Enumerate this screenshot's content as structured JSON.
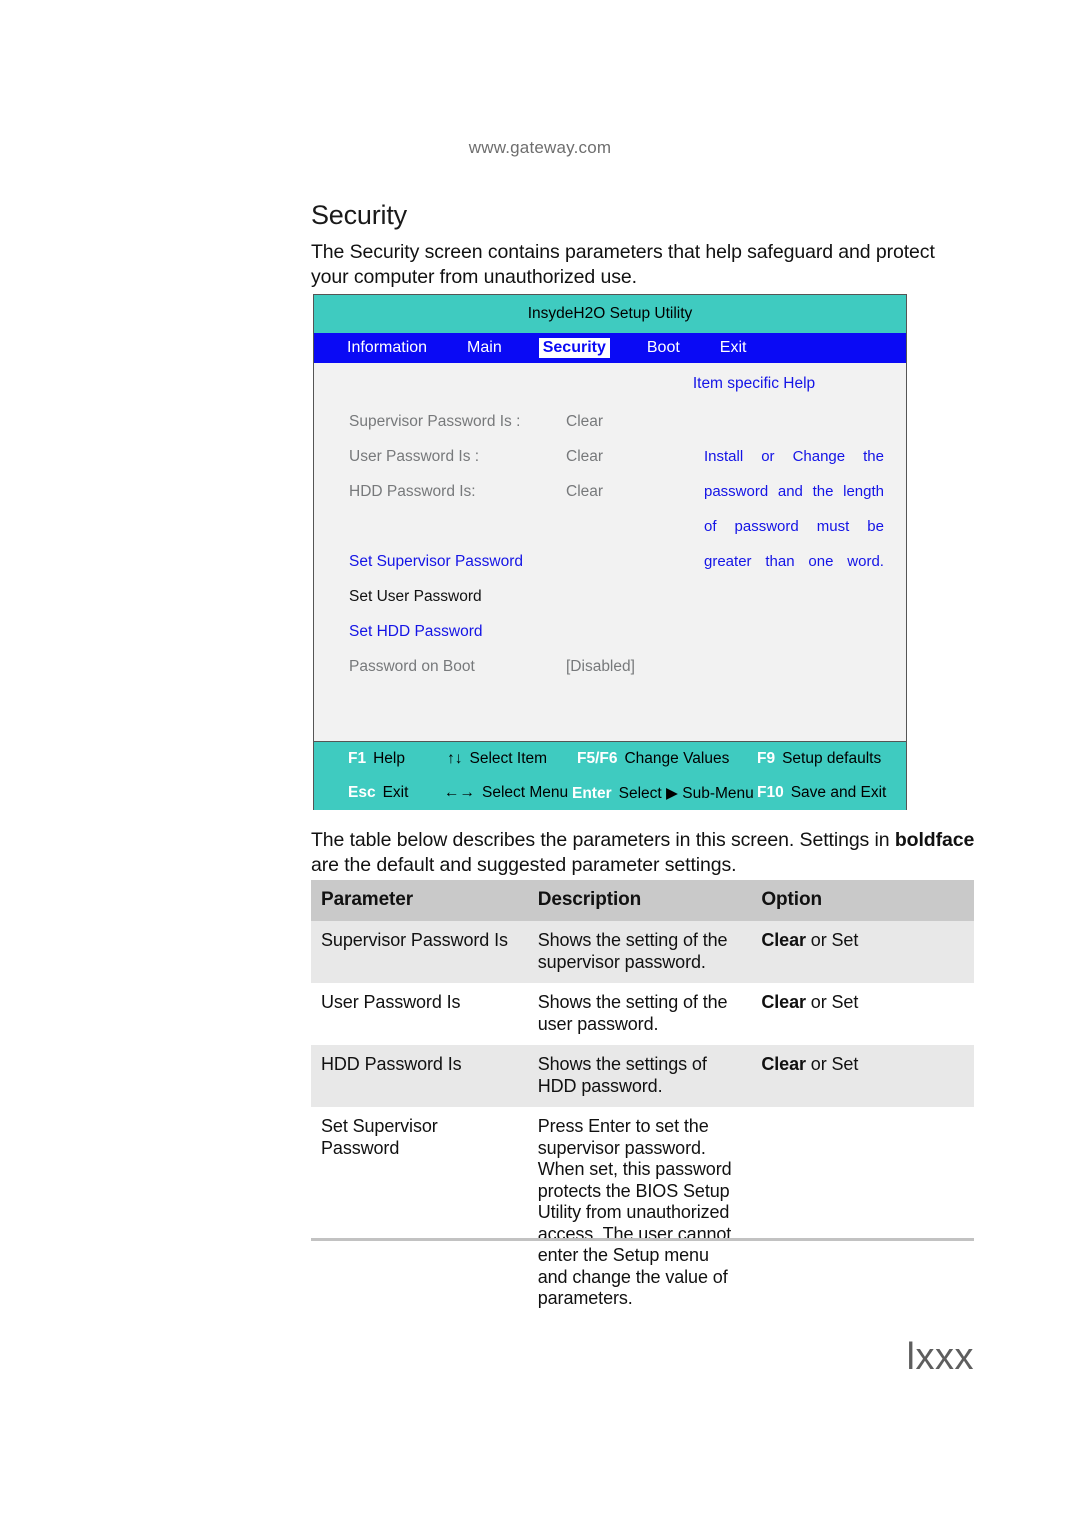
{
  "page": {
    "running_head": "www.gateway.com",
    "folio": "lxxx",
    "section_title": "Security",
    "intro_paragraph": "The Security screen contains parameters that help safeguard and protect your computer from unauthorized use.",
    "table_intro_before_bold": "The table below describes the parameters in this screen. Settings in ",
    "table_intro_bold": "boldface",
    "table_intro_after_bold": " are the default and suggested parameter settings."
  },
  "bios": {
    "title": "InsydeH2O Setup Utility",
    "colors": {
      "titlebar": "#3FCBC0",
      "menubar": "#0A0AF5",
      "body": "#F2F2F2",
      "footer": "#3FCBC0",
      "help_text": "#1414E6",
      "label_gray": "#77797B"
    },
    "tabs": [
      {
        "label": "Information",
        "active": false
      },
      {
        "label": "Main",
        "active": false
      },
      {
        "label": "Security",
        "active": true
      },
      {
        "label": "Boot",
        "active": false
      },
      {
        "label": "Exit",
        "active": false
      }
    ],
    "help_panel": {
      "title": "Item specific Help",
      "lines": [
        [
          "Install",
          "or",
          "Change",
          "the"
        ],
        [
          "password",
          "and",
          "the",
          "length"
        ],
        [
          "of",
          "password",
          "must",
          "be"
        ],
        [
          "greater",
          "than",
          "one",
          "word."
        ]
      ]
    },
    "fields": [
      {
        "label": "Supervisor Password Is :",
        "value": "Clear",
        "style": "gray"
      },
      {
        "label": "User Password Is :",
        "value": "Clear",
        "style": "gray"
      },
      {
        "label": "HDD Password Is:",
        "value": "Clear",
        "style": "gray"
      },
      {
        "label": "Set Supervisor Password",
        "value": "",
        "style": "link"
      },
      {
        "label": "Set User Password",
        "value": "",
        "style": "plain"
      },
      {
        "label": "Set HDD Password",
        "value": "",
        "style": "link"
      },
      {
        "label": "Password on Boot",
        "value": "[Disabled]",
        "style": "gray"
      }
    ],
    "footer_keys": [
      {
        "key": "F1",
        "label": "Help"
      },
      {
        "key": "↑↓",
        "label": "Select Item",
        "key_black": true
      },
      {
        "key": "F5/F6",
        "label": "Change Values"
      },
      {
        "key": "F9",
        "label": "Setup defaults"
      },
      {
        "key": "Esc",
        "label": "Exit"
      },
      {
        "key": "←→",
        "label": "Select Menu",
        "key_black": true
      },
      {
        "key": "Enter",
        "label": "Select ▶ Sub-Menu"
      },
      {
        "key": "F10",
        "label": "Save and Exit"
      }
    ]
  },
  "param_table": {
    "headers": [
      "Parameter",
      "Description",
      "Option"
    ],
    "rows": [
      {
        "parameter": "Supervisor Password Is",
        "description": "Shows the setting of the supervisor password.",
        "option_bold": "Clear",
        "option_rest": " or Set"
      },
      {
        "parameter": "User Password Is",
        "description": "Shows the setting of the user password.",
        "option_bold": "Clear",
        "option_rest": " or Set"
      },
      {
        "parameter": "HDD Password Is",
        "description": "Shows the settings of HDD password.",
        "option_bold": "Clear",
        "option_rest": " or Set"
      },
      {
        "parameter": "Set Supervisor Password",
        "description": "Press Enter to set the supervisor password. When set, this password protects the BIOS Setup Utility from unauthorized access. The user cannot enter the Setup menu and change the value of parameters.",
        "option_bold": "",
        "option_rest": ""
      }
    ]
  }
}
